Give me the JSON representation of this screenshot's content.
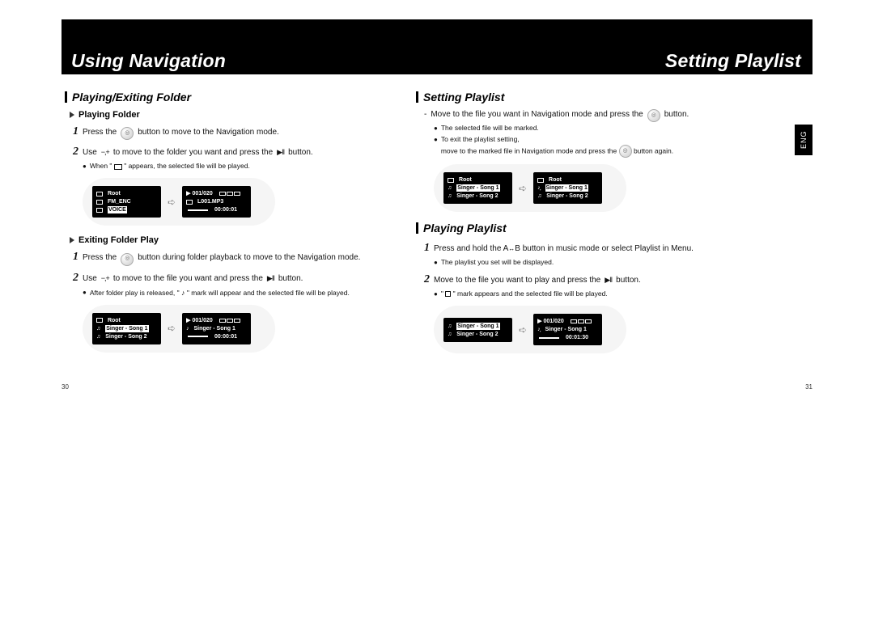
{
  "header": {
    "left_title": "Using Navigation",
    "right_title": "Setting Playlist",
    "lang_tab": "ENG"
  },
  "page_numbers": {
    "left": "30",
    "right": "31"
  },
  "left": {
    "section_title": "Playing/Exiting Folder",
    "sub1": "Playing Folder",
    "step1_a": "Press the",
    "step1_b": "button to move to the Navigation mode.",
    "step2_a": "Use",
    "step2_vm": "−,+",
    "step2_b": "to move to the folder you want and press the",
    "step2_c": "button.",
    "note1": "When \"",
    "note1b": "\" appears, the selected file will be played.",
    "lcd1_left": {
      "root": "Root",
      "l1": "FM_ENC",
      "l2": "VOICE"
    },
    "lcd1_right": {
      "info": "001/020",
      "l1": "L001.MP3",
      "time": "00:00:01"
    },
    "sub2": "Exiting Folder Play",
    "step1b_a": "Press the",
    "step1b_b": "button during folder playback to move to the Navigation mode.",
    "step2b_a": "Use",
    "step2b_vm": "−,+",
    "step2b_b": "to move to the file you want and press the",
    "step2b_c": "button.",
    "note2": "After folder play is released, \"",
    "note2b": "\" mark will appear and the selected file will be played.",
    "lcd2_left": {
      "root": "Root",
      "l1": "Singer - Song 1",
      "l2": "Singer - Song 2"
    },
    "lcd2_right": {
      "info": "001/020",
      "l1": "Singer - Song 1",
      "time": "00:00:01"
    }
  },
  "right": {
    "section1_title": "Setting Playlist",
    "dash_a": "Move to the file you want in Navigation mode and press the",
    "dash_b": "button.",
    "note_a": "The selected file will be marked.",
    "note_b1": "To exit the playlist setting,",
    "note_b2": "move to the marked file in Navigation mode and press the",
    "note_b3": "button again.",
    "lcd1_left": {
      "root": "Root",
      "l1": "Singer - Song 1",
      "l2": "Singer - Song 2"
    },
    "lcd1_right": {
      "root": "Root",
      "l1": "Singer - Song 1",
      "l2": "Singer - Song 2"
    },
    "section2_title": "Playing Playlist",
    "step1_a": "Press and hold the A",
    "step1_b": "B button in music mode or select Playlist in Menu.",
    "note1": "The playlist you set will be displayed.",
    "step2_a": "Move to the file you want to play and press the",
    "step2_b": "button.",
    "note2_a": "\"",
    "note2_b": "\" mark appears and the selected file will be played.",
    "lcd2_left": {
      "l1": "Singer - Song 1",
      "l2": "Singer - Song 2"
    },
    "lcd2_right": {
      "info": "001/020",
      "l1": "Singer - Song 1",
      "time": "00:01:30"
    }
  }
}
